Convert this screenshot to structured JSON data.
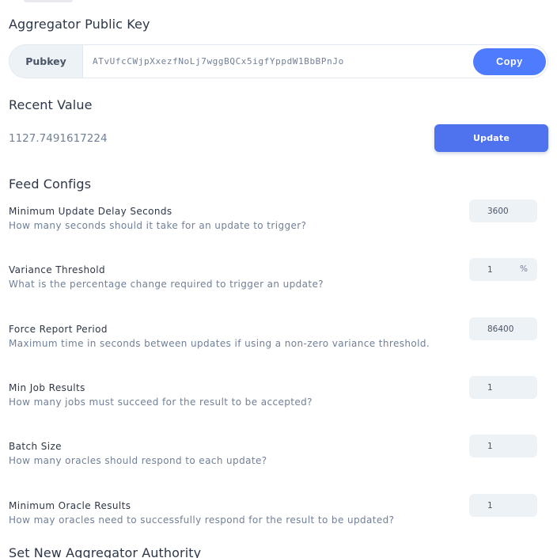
{
  "pubkey_section": {
    "title": "Aggregator Public Key",
    "addon_label": "Pubkey",
    "value": "ATvUfcCWjpXxezfNoLj7wggBQCx5igfYppdW1BbBPnJo",
    "copy_label": "Copy"
  },
  "recent": {
    "title": "Recent Value",
    "value": "1127.7491617224",
    "update_label": "Update"
  },
  "feed_configs": {
    "title": "Feed Configs",
    "rows": [
      {
        "label": "Minimum Update Delay Seconds",
        "description": "How many seconds should it take for an update to trigger?",
        "value": "3600",
        "unit": ""
      },
      {
        "label": "Variance Threshold",
        "description": "What is the percentage change required to trigger an update?",
        "value": "1",
        "unit": "%"
      },
      {
        "label": "Force Report Period",
        "description": "Maximum time in seconds between updates if using a non-zero variance threshold.",
        "value": "86400",
        "unit": ""
      },
      {
        "label": "Min Job Results",
        "description": "How many jobs must succeed for the result to be accepted?",
        "value": "1",
        "unit": ""
      },
      {
        "label": "Batch Size",
        "description": "How many oracles should respond to each update?",
        "value": "1",
        "unit": ""
      },
      {
        "label": "Minimum Oracle Results",
        "description": "How may oracles need to successfully respond for the result to be updated?",
        "value": "1",
        "unit": ""
      }
    ]
  },
  "authority": {
    "title": "Set New Aggregator Authority"
  }
}
